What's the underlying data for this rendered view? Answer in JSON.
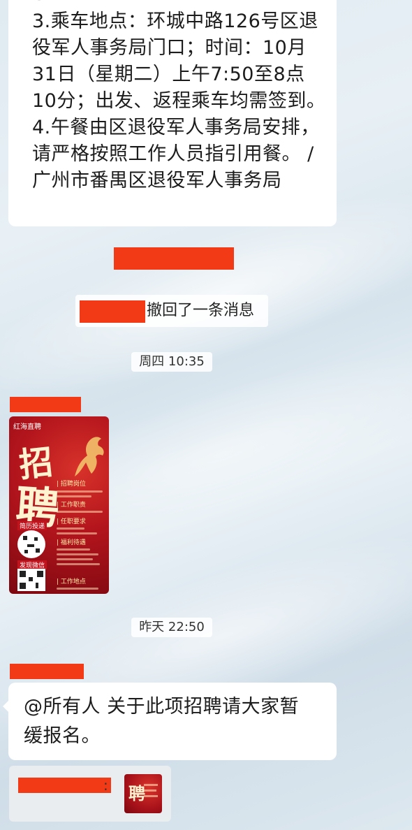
{
  "messages": {
    "notice": {
      "top_partial": "求。",
      "line1": "3.乘车地点：环城中路126号区退",
      "line2": "役军人事务局门口；时间：10月",
      "line3": "31日（星期二）上午7:50至8点",
      "line4": "10分；出发、返程乘车均需签到。",
      "line5": "4.午餐由区退役军人事务局安排，",
      "line6": "请严格按照工作人员指引用餐。 /",
      "line7": "广州市番禺区退役军人事务局"
    },
    "recall_notice": "撤回了一条消息",
    "time1": "周四 10:35",
    "poster": {
      "logo": "红海直聘",
      "char1": "招",
      "char2": "聘",
      "sections": [
        "| 招聘岗位",
        "| 工作职责",
        "| 任职要求",
        "| 福利待遇",
        "| 工作地点"
      ],
      "qr1_label": "简历投递",
      "qr2_label": "发现微信"
    },
    "time2": "昨天 22:50",
    "announcement_line1": "@所有人  关于此项招聘请大家暂",
    "announcement_line2": "缓报名。",
    "quote_separator": ":",
    "thumb_char": "聘"
  },
  "colors": {
    "redaction": "#f23a17",
    "bubble": "#ffffff",
    "poster_red": "#b2141c"
  }
}
